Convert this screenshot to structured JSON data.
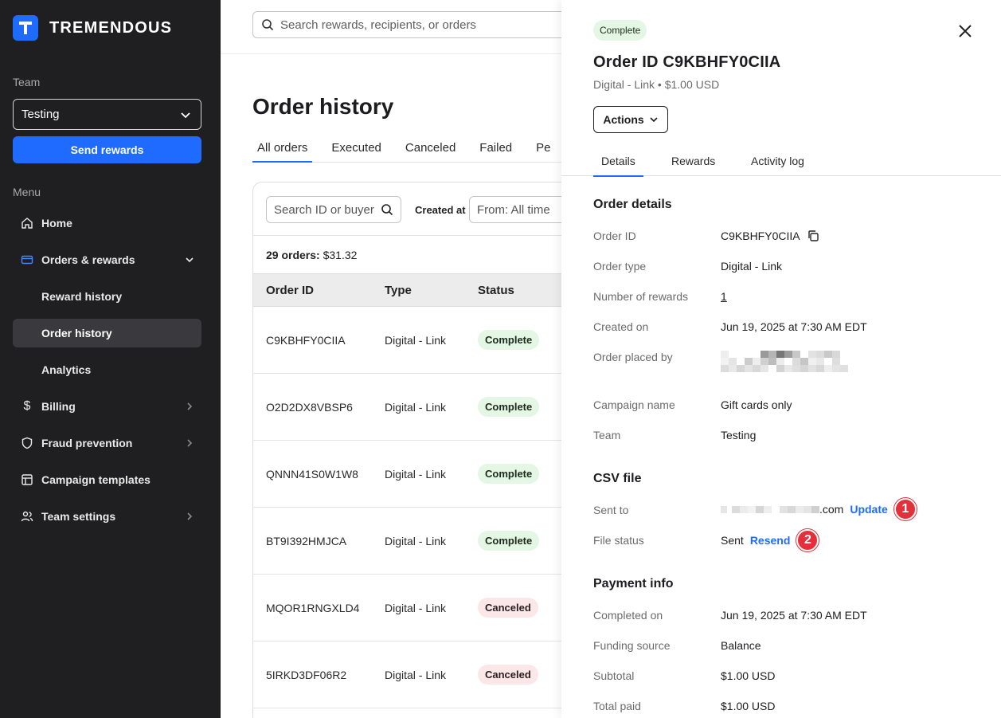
{
  "app": {
    "brand": "TREMENDOUS",
    "brand_letter": "T"
  },
  "sidebar": {
    "team_label": "Team",
    "team_value": "Testing",
    "send_button": "Send rewards",
    "menu_label": "Menu",
    "items": [
      {
        "label": "Home",
        "icon": "home-icon"
      },
      {
        "label": "Orders & rewards",
        "icon": "card-icon"
      },
      {
        "label": "Reward history"
      },
      {
        "label": "Order history"
      },
      {
        "label": "Analytics"
      },
      {
        "label": "Billing",
        "icon": "dollar-icon"
      },
      {
        "label": "Fraud prevention",
        "icon": "shield-icon"
      },
      {
        "label": "Campaign templates",
        "icon": "template-icon"
      },
      {
        "label": "Team settings",
        "icon": "users-icon"
      }
    ]
  },
  "main": {
    "search_placeholder": "Search rewards, recipients, or orders",
    "title": "Order history",
    "tabs": [
      "All orders",
      "Executed",
      "Canceled",
      "Failed",
      "Pe"
    ],
    "filters": {
      "id_search_placeholder": "Search ID or buyer",
      "created_label": "Created at",
      "from_value": "From: All time"
    },
    "summary_count": "29 orders:",
    "summary_total": "$31.32",
    "columns": [
      "Order ID",
      "Type",
      "Status"
    ],
    "rows": [
      {
        "id": "C9KBHFY0CIIA",
        "type": "Digital - Link",
        "status": "Complete"
      },
      {
        "id": "O2D2DX8VBSP6",
        "type": "Digital - Link",
        "status": "Complete"
      },
      {
        "id": "QNNN41S0W1W8",
        "type": "Digital - Link",
        "status": "Complete"
      },
      {
        "id": "BT9I392HMJCA",
        "type": "Digital - Link",
        "status": "Complete"
      },
      {
        "id": "MQOR1RNGXLD4",
        "type": "Digital - Link",
        "status": "Canceled"
      },
      {
        "id": "5IRKD3DF06R2",
        "type": "Digital - Link",
        "status": "Canceled"
      }
    ]
  },
  "drawer": {
    "status": "Complete",
    "title": "Order ID C9KBHFY0CIIA",
    "subtitle": "Digital - Link • $1.00 USD",
    "actions": "Actions",
    "tabs": [
      "Details",
      "Rewards",
      "Activity log"
    ],
    "order_details": {
      "heading": "Order details",
      "order_id_label": "Order ID",
      "order_id": "C9KBHFY0CIIA",
      "order_type_label": "Order type",
      "order_type": "Digital - Link",
      "num_rewards_label": "Number of rewards",
      "num_rewards": "1",
      "created_label": "Created on",
      "created": "Jun 19, 2025 at 7:30 AM EDT",
      "placed_by_label": "Order placed by",
      "campaign_label": "Campaign name",
      "campaign": "Gift cards only",
      "team_label": "Team",
      "team": "Testing"
    },
    "csv": {
      "heading": "CSV file",
      "sent_to_label": "Sent to",
      "sent_to_suffix": ".com",
      "update": "Update",
      "marker1": "1",
      "file_status_label": "File status",
      "file_status": "Sent",
      "resend": "Resend",
      "marker2": "2"
    },
    "payment": {
      "heading": "Payment info",
      "completed_label": "Completed on",
      "completed": "Jun 19, 2025 at 7:30 AM EDT",
      "funding_label": "Funding source",
      "funding": "Balance",
      "subtotal_label": "Subtotal",
      "subtotal": "$1.00 USD",
      "total_label": "Total paid",
      "total": "$1.00 USD"
    }
  },
  "colors": {
    "accent": "#1f6bff",
    "sidebar_bg": "#1f1f21",
    "marker": "#e3303b",
    "complete_bg": "#e4f6e4",
    "canceled_bg": "#fbe7e7"
  }
}
